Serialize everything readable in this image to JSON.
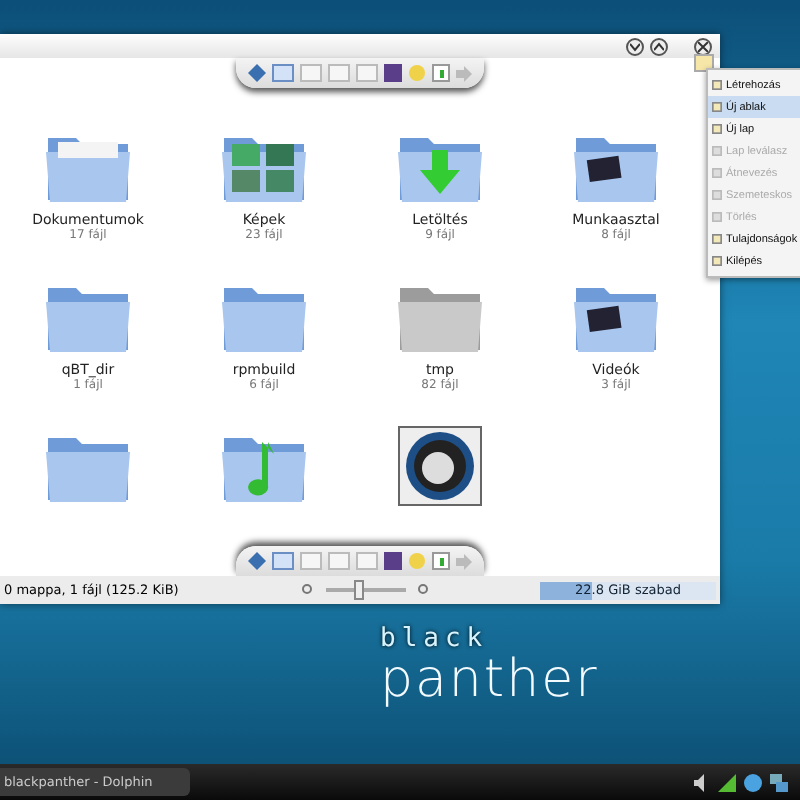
{
  "window": {
    "buttons": [
      {
        "kind": "minimize"
      },
      {
        "kind": "maximize"
      },
      {
        "kind": "close"
      }
    ]
  },
  "top_toolbar": {
    "view_modes": [
      {
        "selected": true
      },
      {
        "selected": false
      },
      {
        "selected": false
      },
      {
        "selected": false
      }
    ]
  },
  "items": [
    {
      "kind": "documents",
      "name": "Dokumentumok",
      "count": "17 fájl"
    },
    {
      "kind": "pictures",
      "name": "Képek",
      "count": "23 fájl"
    },
    {
      "kind": "download",
      "name": "Letöltés",
      "count": "9 fájl"
    },
    {
      "kind": "desktop",
      "name": "Munkaasztal",
      "count": "8 fájl"
    },
    {
      "kind": "folder",
      "name": "qBT_dir",
      "count": "1 fájl"
    },
    {
      "kind": "folder",
      "name": "rpmbuild",
      "count": "6 fájl"
    },
    {
      "kind": "grey",
      "name": "tmp",
      "count": "82 fájl"
    },
    {
      "kind": "video",
      "name": "Videók",
      "count": "3 fájl"
    },
    {
      "kind": "folder"
    },
    {
      "kind": "music"
    },
    {
      "kind": "disc"
    }
  ],
  "bottom_toolbar": {
    "view_modes": [
      {
        "selected": true
      },
      {
        "selected": false
      },
      {
        "selected": false
      },
      {
        "selected": false
      }
    ]
  },
  "status_bar": {
    "text": "0 mappa, 1 fájl (125.2 KiB)",
    "zoom": {
      "level": 0.4
    },
    "free_space": {
      "text": "22.8 GiB szabad",
      "level": 0.3
    }
  },
  "context_menu": [
    {
      "label": "Létrehozás",
      "selected": false,
      "disabled": false
    },
    {
      "label": "Új ablak",
      "selected": true,
      "disabled": false
    },
    {
      "label": "Új lap",
      "selected": false,
      "disabled": false
    },
    {
      "label": "Lap leválasz",
      "selected": false,
      "disabled": true
    },
    {
      "label": "Átnevezés",
      "selected": false,
      "disabled": true
    },
    {
      "label": "Szemeteskos",
      "selected": false,
      "disabled": true
    },
    {
      "label": "Törlés",
      "selected": false,
      "disabled": true
    },
    {
      "label": "Tulajdonságok",
      "selected": false,
      "disabled": false
    },
    {
      "label": "Kilépés",
      "selected": false,
      "disabled": false
    }
  ],
  "wallpaper": {
    "logo_top": "black",
    "logo_bottom": "panther"
  },
  "taskbar": {
    "task": "blackpanther - Dolphin"
  }
}
